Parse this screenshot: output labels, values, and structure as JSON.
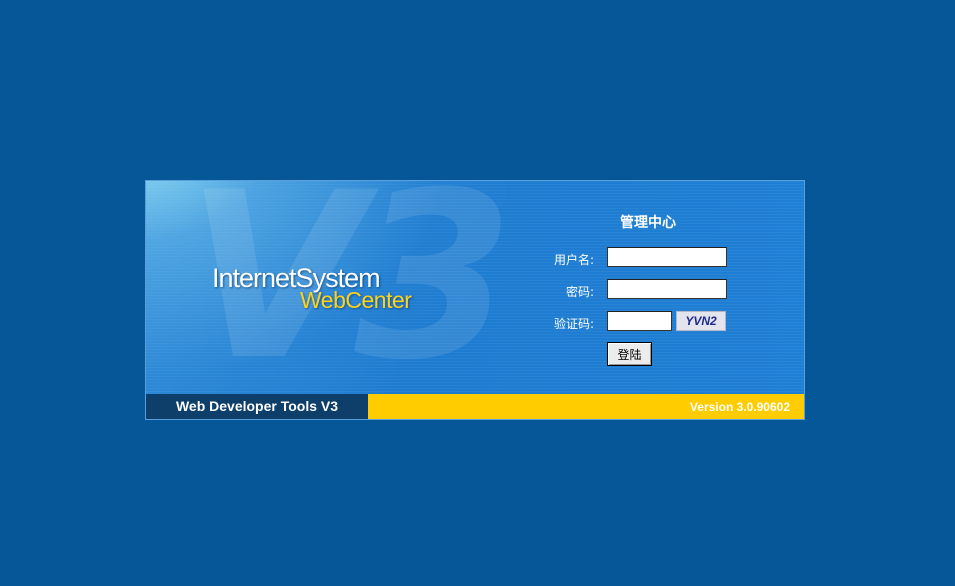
{
  "brand": {
    "watermark": "V3",
    "line1": "InternetSystem",
    "line2": "WebCenter"
  },
  "login": {
    "title": "管理中心",
    "username_label": "用户名:",
    "username_value": "",
    "password_label": "密码:",
    "password_value": "",
    "captcha_label": "验证码:",
    "captcha_value": "",
    "captcha_image_text": "YVN2",
    "submit_label": "登陆"
  },
  "footer": {
    "left_text": "Web Developer Tools V3",
    "version_text": "Version 3.0.90602"
  },
  "colors": {
    "page_background": "#055797",
    "panel_blue": "#1f7fd4",
    "footer_dark": "#0d3f6a",
    "footer_yellow": "#ffcc00",
    "brand_yellow": "#ffd21a"
  }
}
